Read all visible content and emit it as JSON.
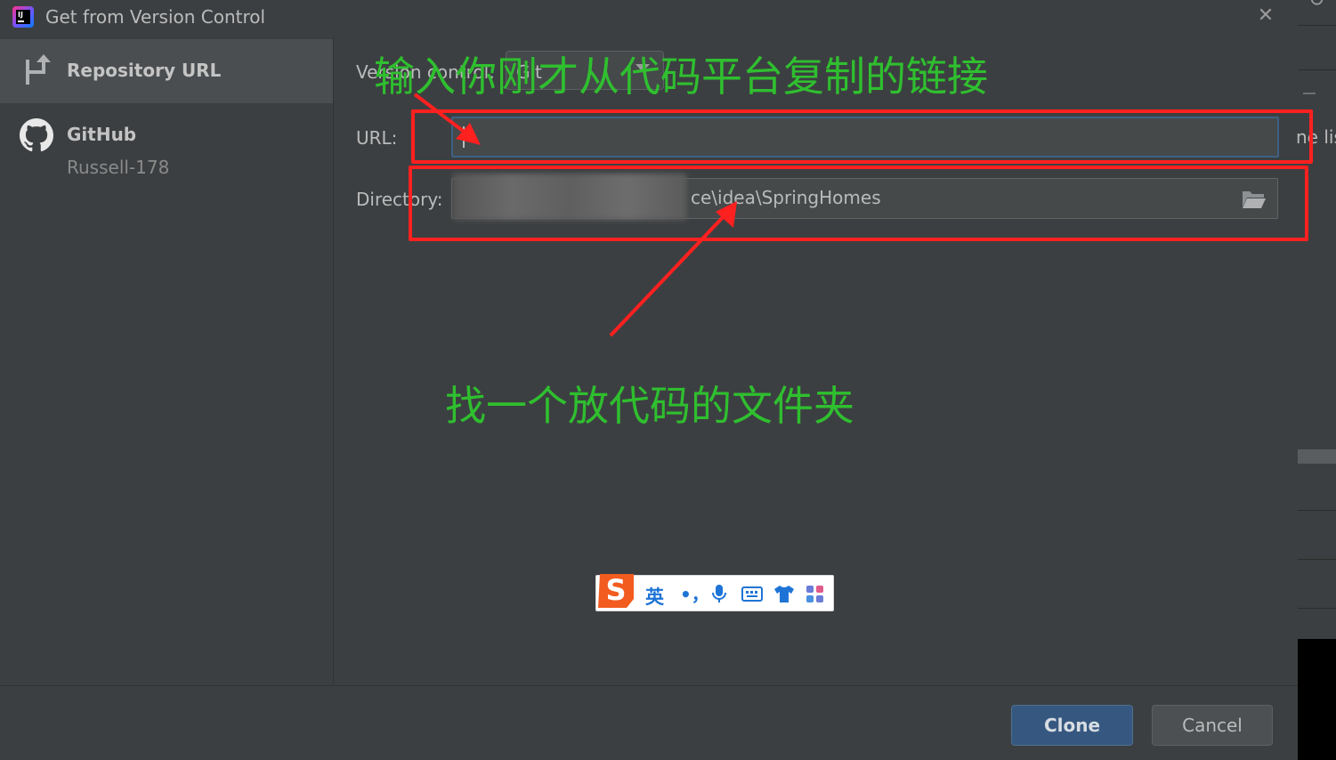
{
  "window": {
    "title": "Get from Version Control"
  },
  "sidebar": {
    "items": [
      {
        "label": "Repository URL",
        "icon": "repository-url-icon",
        "selected": true
      },
      {
        "label": "GitHub",
        "sublabel": "Russell-178",
        "icon": "github-icon",
        "selected": false
      }
    ]
  },
  "form": {
    "version_control_label": "Version control:",
    "version_control_value": "Git",
    "url_label": "URL:",
    "url_value": "",
    "directory_label": "Directory:",
    "directory_value": "ce\\idea\\SpringHomes"
  },
  "buttons": {
    "clone": "Clone",
    "cancel": "Cancel"
  },
  "annotations": {
    "top": "输入你刚才从代码平台复制的链接",
    "bottom": "找一个放代码的文件夹",
    "color": "#2fbf2f",
    "box_color": "#ff2020"
  },
  "background": {
    "partial_text": "ne lis"
  },
  "ime": {
    "lang": "英",
    "punct": "•，"
  },
  "colors": {
    "accent": "#365880",
    "focus_border": "#3d6185",
    "background": "#3c3f41"
  }
}
